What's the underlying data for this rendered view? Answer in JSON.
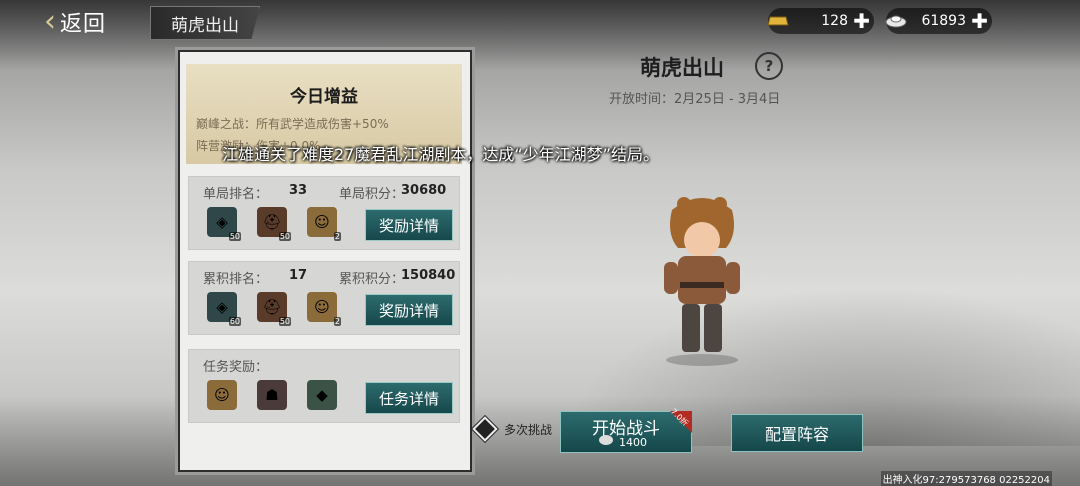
{
  "top_bar": {
    "back_label": "返回",
    "tab_label": "萌虎出山",
    "gold": {
      "icon": "gold-ingot-icon",
      "value": "128"
    },
    "silver": {
      "icon": "silver-ingot-icon",
      "value": "61893"
    }
  },
  "buff_panel": {
    "title": "今日增益",
    "line1": "巅峰之战：所有武学造成伤害+50%",
    "line2": "阵营激励：伤害+0.0%"
  },
  "single": {
    "rank_label": "单局排名：",
    "rank_value": "33",
    "score_label": "单局积分：",
    "score_value": "30680",
    "items": [
      {
        "name": "jade-token-icon",
        "count": "50"
      },
      {
        "name": "helmet-chest-icon",
        "count": "50"
      },
      {
        "name": "hero-portrait-icon",
        "count": "2"
      }
    ],
    "button": "奖励详情"
  },
  "total": {
    "rank_label": "累积排名：",
    "rank_value": "17",
    "score_label": "累积积分：",
    "score_value": "150840",
    "items": [
      {
        "name": "jade-token-icon",
        "count": "60"
      },
      {
        "name": "helmet-chest-icon",
        "count": "50"
      },
      {
        "name": "hero-portrait-icon",
        "count": "2"
      }
    ],
    "button": "奖励详情"
  },
  "task": {
    "label": "任务奖励：",
    "items": [
      {
        "name": "hero-portrait-icon"
      },
      {
        "name": "masked-figure-icon"
      },
      {
        "name": "dark-figure-icon"
      }
    ],
    "button": "任务详情"
  },
  "event": {
    "title": "萌虎出山",
    "time": "开放时间：2月25日 - 3月4日"
  },
  "broadcast": "江雄通关了难度27魔君乱江湖剧本，达成“少年江湖梦”结局。",
  "actions": {
    "multi_label": "多次挑战",
    "start_label": "开始战斗",
    "start_cost": "1400",
    "start_discount": "7.0折",
    "lineup_label": "配置阵容"
  },
  "watermark": "出神入化97:279573768 02252204",
  "colors": {
    "button": "#16484b",
    "panel": "#efefee",
    "buff": "#d7c9a3"
  }
}
